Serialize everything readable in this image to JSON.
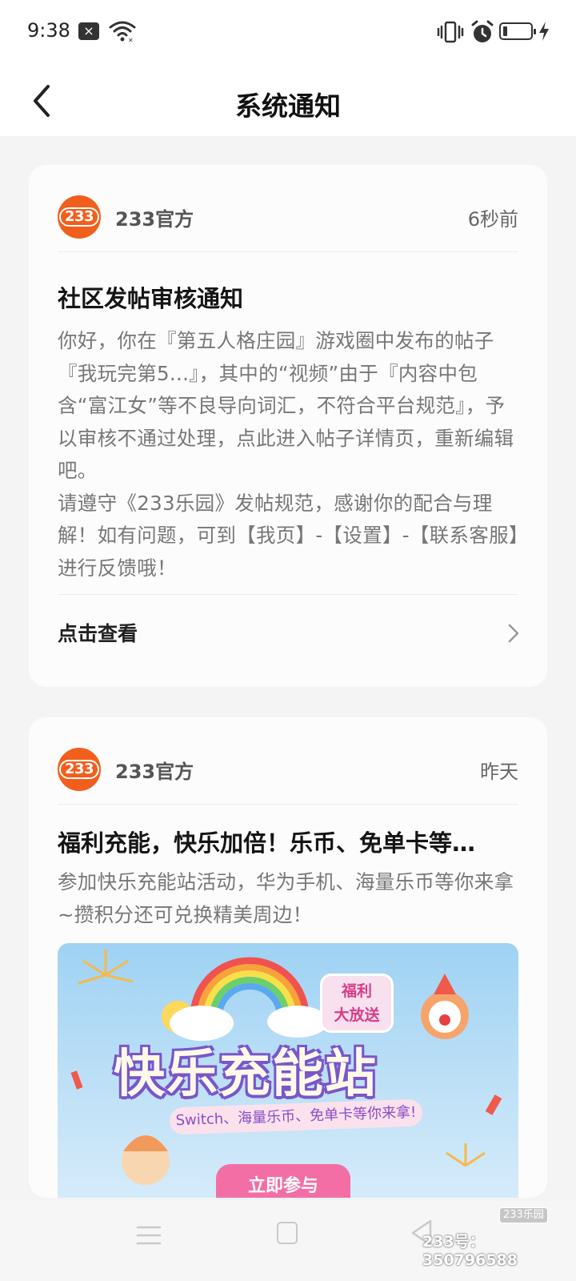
{
  "status_bar": {
    "time": "9:38",
    "notification_x": "×"
  },
  "header": {
    "title": "系统通知"
  },
  "notifications": [
    {
      "sender": "233官方",
      "avatar_text": "233",
      "time": "6秒前",
      "title": "社区发帖审核通知",
      "body": "你好，你在『第五人格庄园』游戏圈中发布的帖子『我玩完第5...』，其中的“视频”由于『内容中包含“富江女”等不良导向词汇，不符合平台规范』，予以审核不通过处理，点此进入帖子详情页，重新编辑吧。\n请遵守《233乐园》发帖规范，感谢你的配合与理解！如有问题，可到【我页】-【设置】-【联系客服】进行反馈哦！",
      "action": "点击查看"
    },
    {
      "sender": "233官方",
      "avatar_text": "233",
      "time": "昨天",
      "title": "福利充能，快乐加倍！乐币、免单卡等…",
      "body": "参加快乐充能站活动，华为手机、海量乐币等你来拿~攒积分还可兑换精美周边！",
      "banner": {
        "badge": "福利\n大放送",
        "headline": "快乐充能站",
        "subtitle": "Switch、海量乐币、免单卡等你来拿!",
        "button": "立即参与"
      }
    }
  ],
  "watermark": {
    "logo": "233乐园",
    "id": "233号：350796588"
  },
  "colors": {
    "accent": "#f25e1c",
    "background": "#f5f4f5",
    "card": "#fdfcfd"
  }
}
